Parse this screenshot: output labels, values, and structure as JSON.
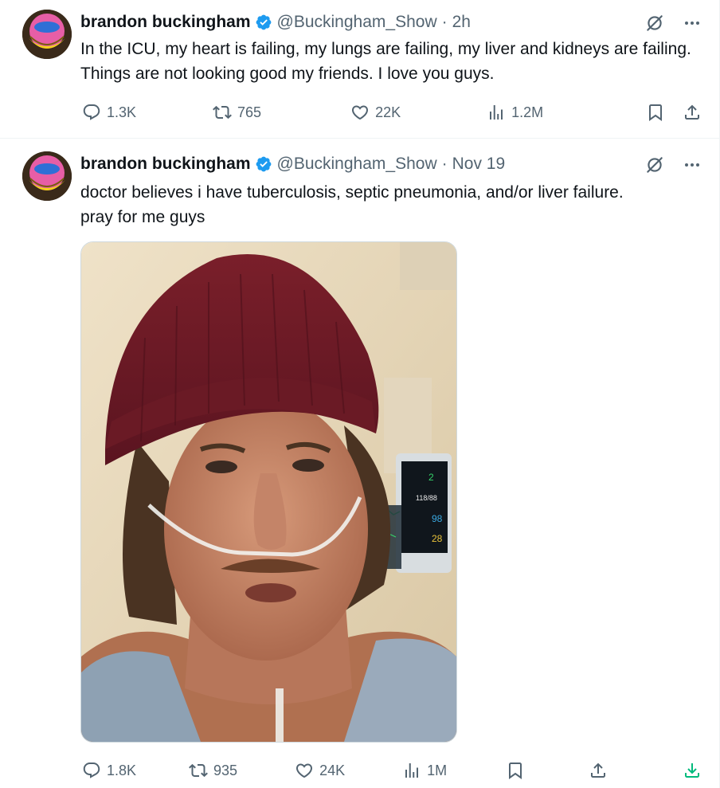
{
  "tweets": [
    {
      "name": "brandon buckingham",
      "handle": "@Buckingham_Show",
      "separator": "·",
      "time": "2h",
      "text": "In the ICU, my heart is failing, my lungs are failing, my liver and kidneys are failing. Things are not looking good my friends. I love you guys.",
      "stats": {
        "replies": "1.3K",
        "reposts": "765",
        "likes": "22K",
        "views": "1.2M"
      }
    },
    {
      "name": "brandon buckingham",
      "handle": "@Buckingham_Show",
      "separator": "·",
      "time": "Nov 19",
      "text_lines": [
        "doctor believes i have tuberculosis, septic pneumonia, and/or liver failure.",
        "pray for me guys"
      ],
      "stats": {
        "replies": "1.8K",
        "reposts": "935",
        "likes": "24K",
        "views": "1M"
      },
      "monitor": {
        "hr": "2",
        "bp": "118/88",
        "spo2": "98",
        "rr": "28"
      }
    }
  ],
  "colors": {
    "verified": "#1d9bf0",
    "secondary": "#536471",
    "download": "#00ba7c"
  }
}
